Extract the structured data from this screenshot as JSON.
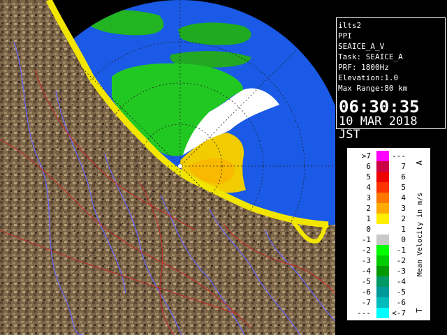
{
  "info": {
    "site": "ilts2",
    "mode": "PPI",
    "product": "SEAICE_A_V",
    "task": "Task: SEAICE_A",
    "prf": "PRF: 1800Hz",
    "elevation": "Elevation:1.0",
    "max_range": "Max Range:80 km",
    "time": "06:30:35",
    "date": "10 MAR 2018 JST"
  },
  "legend": {
    "title": "Mean Velocity in m/s",
    "top_marker": "A",
    "bottom_marker": "T",
    "rows": [
      {
        "left": ">7",
        "right": "---",
        "color": "#ff00ff"
      },
      {
        "left": "6",
        "right": "7",
        "color": "#cc0044"
      },
      {
        "left": "5",
        "right": "6",
        "color": "#ee0000"
      },
      {
        "left": "4",
        "right": "5",
        "color": "#ff3300"
      },
      {
        "left": "3",
        "right": "4",
        "color": "#ff7700"
      },
      {
        "left": "2",
        "right": "3",
        "color": "#ffaa00"
      },
      {
        "left": "1",
        "right": "2",
        "color": "#ffee00"
      },
      {
        "left": "0",
        "right": "1",
        "color": "#ffffff"
      },
      {
        "left": "-1",
        "right": "0",
        "color": "#c8c8c8"
      },
      {
        "left": "-2",
        "right": "-1",
        "color": "#00ff00"
      },
      {
        "left": "-3",
        "right": "-2",
        "color": "#00cc00"
      },
      {
        "left": "-4",
        "right": "-3",
        "color": "#009900"
      },
      {
        "left": "-5",
        "right": "-4",
        "color": "#009966"
      },
      {
        "left": "-6",
        "right": "-5",
        "color": "#009999"
      },
      {
        "left": "-7",
        "right": "-6",
        "color": "#00bbbb"
      },
      {
        "left": "---",
        "right": "<-7",
        "color": "#00ffff"
      }
    ]
  },
  "colors": {
    "sea": "#1a5ae6",
    "land": "#7a6448",
    "coast": "#f2e600",
    "river": "#6a66ff",
    "road": "#c0302c",
    "approach_green": "#22c822",
    "recede_yellow": "#f0d000",
    "zero_white": "#ffffff"
  }
}
